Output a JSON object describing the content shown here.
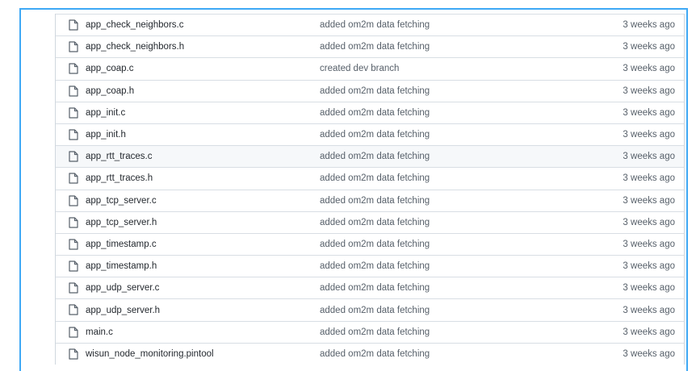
{
  "files": [
    {
      "name": "app_check_neighbors.c",
      "message": "added om2m data fetching",
      "age": "3 weeks ago",
      "icon": "file-icon"
    },
    {
      "name": "app_check_neighbors.h",
      "message": "added om2m data fetching",
      "age": "3 weeks ago",
      "icon": "file-icon"
    },
    {
      "name": "app_coap.c",
      "message": "created dev branch",
      "age": "3 weeks ago",
      "icon": "file-icon"
    },
    {
      "name": "app_coap.h",
      "message": "added om2m data fetching",
      "age": "3 weeks ago",
      "icon": "file-icon"
    },
    {
      "name": "app_init.c",
      "message": "added om2m data fetching",
      "age": "3 weeks ago",
      "icon": "file-icon"
    },
    {
      "name": "app_init.h",
      "message": "added om2m data fetching",
      "age": "3 weeks ago",
      "icon": "file-icon"
    },
    {
      "name": "app_rtt_traces.c",
      "message": "added om2m data fetching",
      "age": "3 weeks ago",
      "icon": "file-icon"
    },
    {
      "name": "app_rtt_traces.h",
      "message": "added om2m data fetching",
      "age": "3 weeks ago",
      "icon": "file-icon"
    },
    {
      "name": "app_tcp_server.c",
      "message": "added om2m data fetching",
      "age": "3 weeks ago",
      "icon": "file-icon"
    },
    {
      "name": "app_tcp_server.h",
      "message": "added om2m data fetching",
      "age": "3 weeks ago",
      "icon": "file-icon"
    },
    {
      "name": "app_timestamp.c",
      "message": "added om2m data fetching",
      "age": "3 weeks ago",
      "icon": "file-icon"
    },
    {
      "name": "app_timestamp.h",
      "message": "added om2m data fetching",
      "age": "3 weeks ago",
      "icon": "file-icon"
    },
    {
      "name": "app_udp_server.c",
      "message": "added om2m data fetching",
      "age": "3 weeks ago",
      "icon": "file-icon"
    },
    {
      "name": "app_udp_server.h",
      "message": "added om2m data fetching",
      "age": "3 weeks ago",
      "icon": "file-icon"
    },
    {
      "name": "main.c",
      "message": "added om2m data fetching",
      "age": "3 weeks ago",
      "icon": "file-icon"
    },
    {
      "name": "wisun_node_monitoring.pintool",
      "message": "added om2m data fetching",
      "age": "3 weeks ago",
      "icon": "file-icon"
    }
  ],
  "colors": {
    "frame_border": "#3fa9f5",
    "row_border": "#d8dee4",
    "hover_row": "#f6f8fa",
    "text": "#24292f",
    "muted_text": "#57606a"
  }
}
